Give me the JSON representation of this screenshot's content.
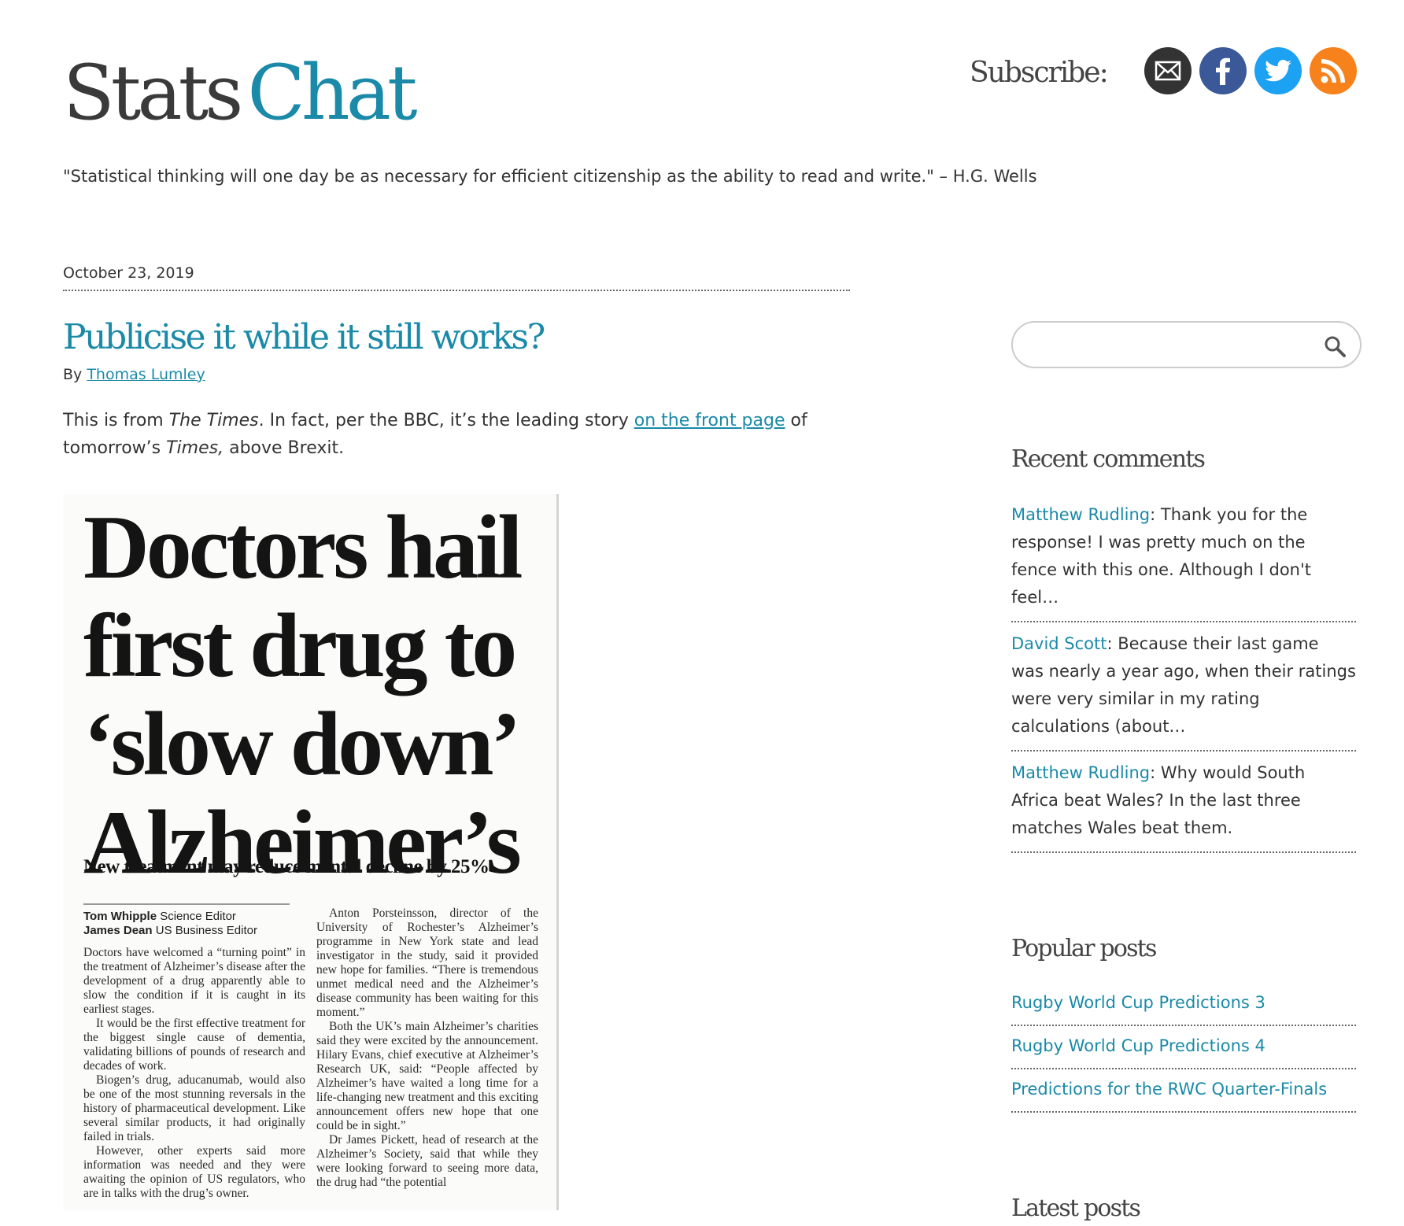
{
  "site": {
    "logo_part1": "Stats",
    "logo_part2": "Chat",
    "subscribe_label": "Subscribe:",
    "tagline": "\"Statistical thinking will one day be as necessary for efficient citizenship as the ability to read and write.\" – H.G. Wells"
  },
  "social": [
    {
      "name": "email",
      "icon": "envelope-icon",
      "color": "#333333"
    },
    {
      "name": "facebook",
      "icon": "facebook-icon",
      "color": "#3b5998"
    },
    {
      "name": "twitter",
      "icon": "twitter-icon",
      "color": "#1da1f2"
    },
    {
      "name": "rss",
      "icon": "rss-icon",
      "color": "#f7811a"
    }
  ],
  "post": {
    "date": "October 23, 2019",
    "title": "Publicise it while it still works?",
    "byline_prefix": "By ",
    "author": "Thomas Lumley",
    "body": {
      "t1": "This is from ",
      "em1": "The Times",
      "t2": ". In fact, per the BBC, it’s the leading story ",
      "link": "on the front page",
      "t3": " of tomorrow’s ",
      "em2": "Times,",
      "t4": " above Brexit."
    },
    "clipping": {
      "headline": [
        "Doctors hail",
        "first drug to",
        "‘slow down’",
        "Alzheimer’s"
      ],
      "subheadline": "New treatment may reduce mental decline by 25%",
      "bylines": [
        {
          "name": "Tom Whipple",
          "role": " Science Editor"
        },
        {
          "name": "James Dean",
          "role": " US Business Editor"
        }
      ],
      "col1": [
        "Doctors have welcomed a “turning point” in the treatment of Alzheimer’s disease after the development of a drug apparently able to slow the condition if it is caught in its earliest stages.",
        "It would be the first effective treatment for the biggest single cause of dementia, validating billions of pounds of research and decades of work.",
        "Biogen’s drug, aducanumab, would also be one of the most stunning reversals in the history of pharmaceutical development. Like several similar products, it had originally failed in trials.",
        "However, other experts said more information was needed and they were awaiting the opinion of US regulators, who are in talks with the drug’s owner."
      ],
      "col2": [
        "Anton Porsteinsson, director of the University of Rochester’s Alzheimer’s programme in New York state and lead investigator in the study, said it provided new hope for families. “There is tremendous unmet medical need and the Alzheimer’s disease community has been waiting for this moment.”",
        "Both the UK’s main Alzheimer’s charities said they were excited by the announcement. Hilary Evans, chief executive at Alzheimer’s Research UK, said: “People affected by Alzheimer’s have waited a long time for a life-changing new treatment and this exciting announcement offers new hope that one could be in sight.”",
        "Dr James Pickett, head of research at the Alzheimer’s Society, said that while they were looking forward to seeing more data, the drug had “the potential"
      ]
    }
  },
  "sidebar": {
    "search_placeholder": "",
    "recent_comments_title": "Recent comments",
    "comments": [
      {
        "author": "Matthew Rudling",
        "text": ": Thank you for the response! I was pretty much on the fence with this one. Although I don't feel…"
      },
      {
        "author": "David Scott",
        "text": ": Because their last game was nearly a year ago, when their ratings were very similar in my rating calculations (about…"
      },
      {
        "author": "Matthew Rudling",
        "text": ": Why would South Africa beat Wales? In the last three matches Wales beat them."
      }
    ],
    "popular_title": "Popular posts",
    "popular": [
      "Rugby World Cup Predictions 3",
      "Rugby World Cup Predictions 4",
      "Predictions for the RWC Quarter-Finals"
    ],
    "latest_title": "Latest posts"
  },
  "colors": {
    "accent": "#1a8aa8",
    "text": "#333333"
  }
}
